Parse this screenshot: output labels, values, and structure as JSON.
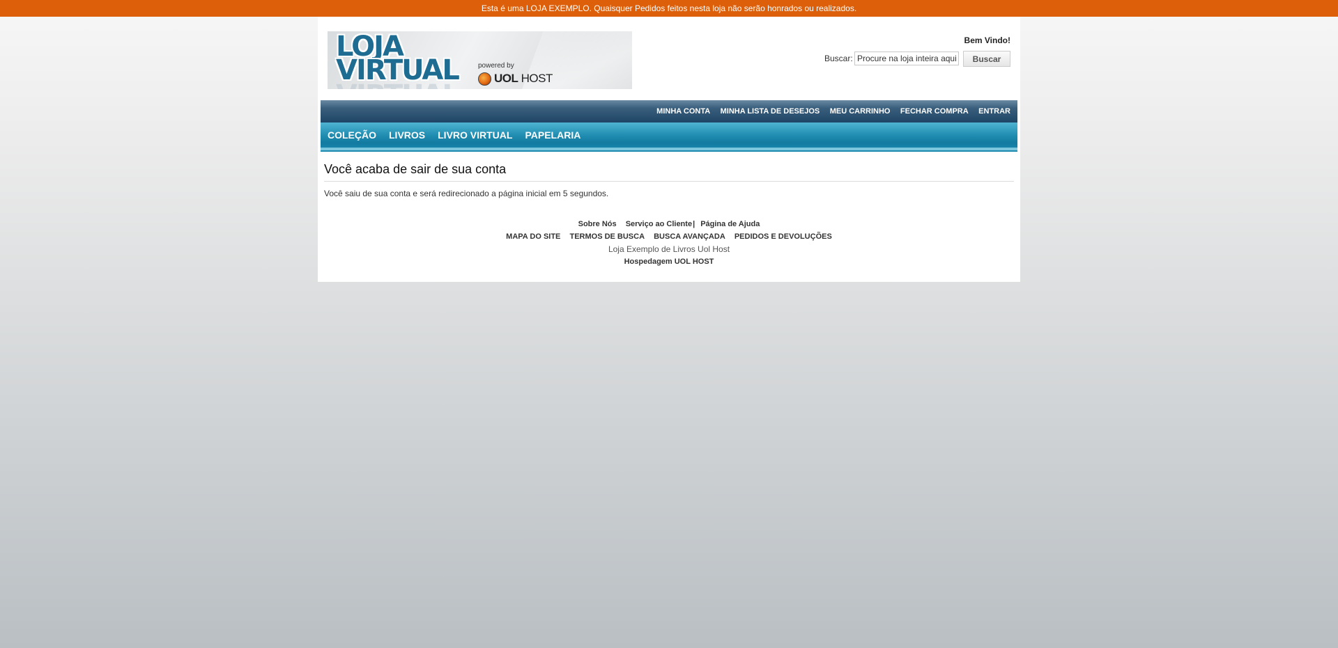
{
  "demo_notice": "Esta é uma LOJA EXEMPLO. Quaisquer Pedidos feitos nesta loja não serão honrados ou realizados.",
  "header": {
    "logo": {
      "line1": "LOJA",
      "line2": "VIRTUAL",
      "powered_by": "powered by",
      "brand_bold": "UOL",
      "brand_rest": "HOST"
    },
    "welcome": "Bem Vindo!",
    "search": {
      "label": "Buscar:",
      "value": "Procure na loja inteira aqui",
      "button": "Buscar"
    }
  },
  "top_links": [
    "MINHA CONTA",
    "MINHA LISTA DE DESEJOS",
    "MEU CARRINHO",
    "FECHAR COMPRA",
    "ENTRAR"
  ],
  "categories": [
    "COLEÇÃO",
    "LIVROS",
    "LIVRO VIRTUAL",
    "PAPELARIA"
  ],
  "main": {
    "title": "Você acaba de sair de sua conta",
    "message": "Você saiu de sua conta e será redirecionado a página inicial em 5 segundos."
  },
  "footer": {
    "row1": [
      "Sobre Nós",
      "Serviço ao Cliente",
      "Página de Ajuda"
    ],
    "row1_separator": "|",
    "row2": [
      "MAPA DO SITE",
      "TERMOS DE BUSCA",
      "BUSCA AVANÇADA",
      "PEDIDOS E DEVOLUÇÕES"
    ],
    "store_name": "Loja Exemplo de Livros Uol Host",
    "hosting": "Hospedagem UOL HOST"
  },
  "colors": {
    "notice_bar": "#dd5f0a",
    "top_links_bar": "#1f4566",
    "category_bar": "#1f8cb0"
  }
}
